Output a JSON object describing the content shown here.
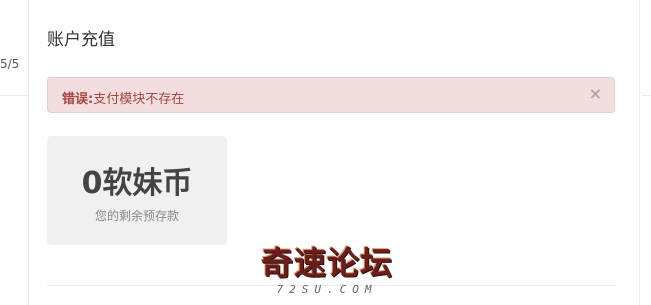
{
  "left_column": {
    "fragment": "5/5"
  },
  "page_title": "账户充值",
  "alert": {
    "label": "错误:",
    "message": "支付模块不存在",
    "close": "×"
  },
  "balance": {
    "amount": "0软妹币",
    "caption": "您的剩余预存款"
  },
  "watermark": {
    "title": "奇速论坛",
    "subtitle": "72SU.COM"
  },
  "colors": {
    "alert_bg": "#f2dede",
    "alert_text": "#a94442",
    "card_bg": "#f0f0f0"
  }
}
